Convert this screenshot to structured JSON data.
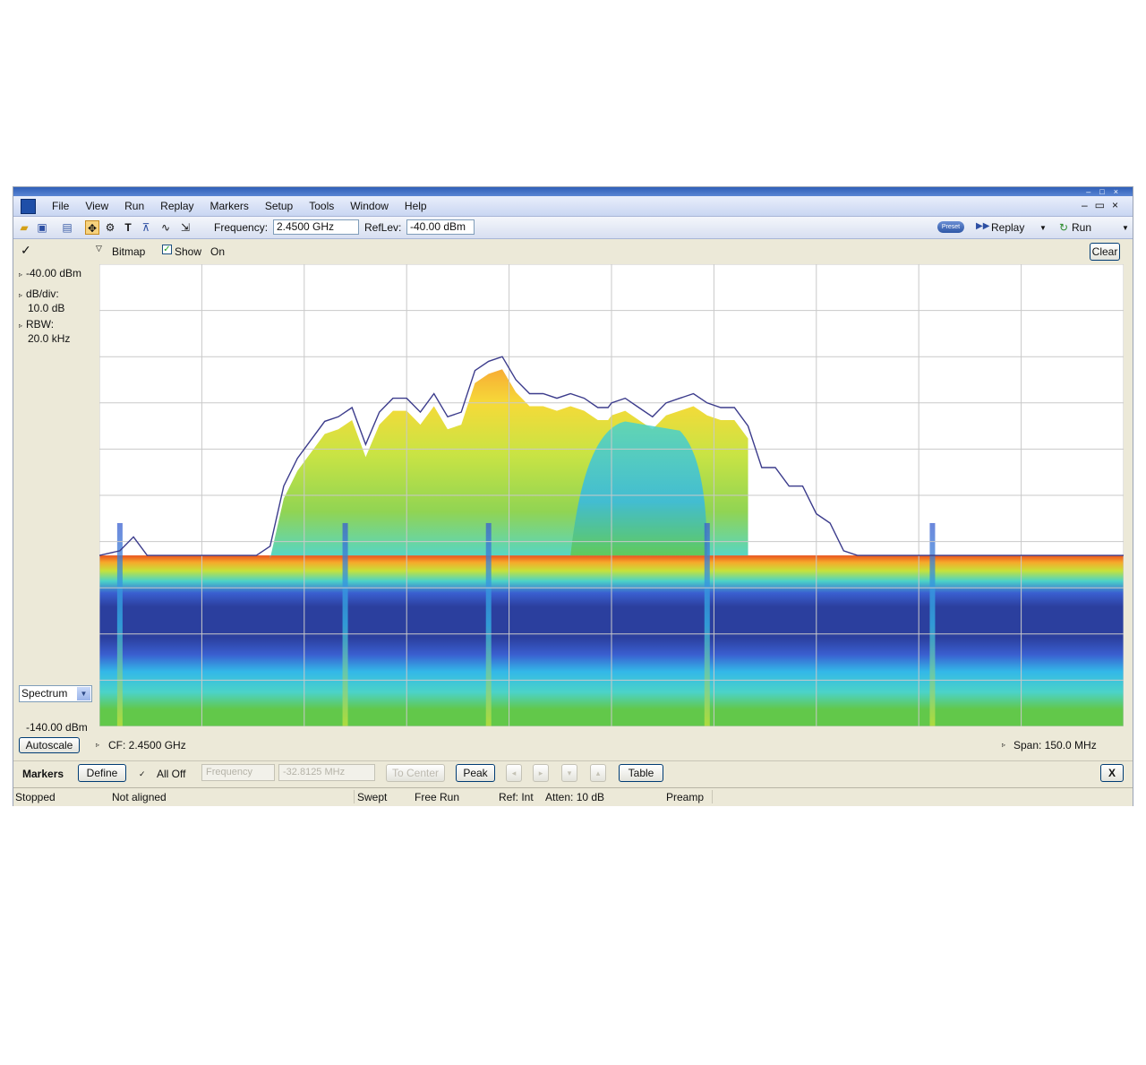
{
  "menu": [
    "File",
    "View",
    "Run",
    "Replay",
    "Markers",
    "Setup",
    "Tools",
    "Window",
    "Help"
  ],
  "toolbar": {
    "frequency_label": "Frequency:",
    "frequency_value": "2.4500 GHz",
    "reflev_label": "RefLev:",
    "reflev_value": "-40.00 dBm",
    "preset_label": "Preset",
    "replay_label": "Replay",
    "run_label": "Run"
  },
  "trace": {
    "mode": "Bitmap",
    "show_label": "Show",
    "show_checked": true,
    "state": "On",
    "clear_label": "Clear"
  },
  "left": {
    "ref_level": "-40.00 dBm",
    "dbdiv_label": "dB/div:",
    "dbdiv_value": "10.0 dB",
    "rbw_label": "RBW:",
    "rbw_value": "20.0 kHz",
    "display_select": "Spectrum",
    "bottom_level": "-140.00 dBm",
    "autoscale_label": "Autoscale"
  },
  "readout": {
    "cf": "CF: 2.4500 GHz",
    "span": "Span: 150.0 MHz"
  },
  "markers": {
    "title": "Markers",
    "define_label": "Define",
    "alloff_label": "All Off",
    "param_select": "Frequency",
    "param_value": "-32.8125 MHz",
    "tocenter_label": "To Center",
    "peak_label": "Peak",
    "table_label": "Table",
    "close_label": "X"
  },
  "status": {
    "state": "Stopped",
    "align": "Not aligned",
    "mode": "Swept",
    "trigger": "Free Run",
    "ref": "Ref: Int",
    "atten": "Atten: 10 dB",
    "preamp": "Preamp"
  },
  "chart_data": {
    "type": "line",
    "xlabel": "",
    "ylabel": "",
    "center_frequency_ghz": 2.45,
    "span_mhz": 150,
    "xlim_mhz": [
      -75,
      75
    ],
    "ylim_dbm": [
      -140,
      -40
    ],
    "grid": true,
    "x_divisions": 10,
    "y_divisions": 10,
    "series": [
      {
        "x": [
          -75,
          -72,
          -70,
          -68,
          -65,
          -60,
          -55,
          -52,
          -50,
          -48,
          -46,
          -44,
          -42,
          -40,
          -38,
          -36,
          -34,
          -32,
          -30,
          -28,
          -26,
          -24,
          -22,
          -20,
          -18,
          -16,
          -14,
          -12,
          -10,
          -8,
          -6,
          -4,
          -2,
          0,
          2,
          4,
          6,
          8,
          10,
          12,
          14,
          16,
          18,
          -0.5,
          20,
          22,
          24,
          26,
          28,
          30,
          32,
          34,
          36,
          38,
          40,
          42,
          44,
          46,
          48,
          50,
          52,
          54,
          56,
          58,
          60,
          62,
          64,
          66,
          68,
          70,
          72,
          75
        ],
        "y": [
          -103,
          -102,
          -99,
          -103,
          -103,
          -103,
          -103,
          -103,
          -101,
          -88,
          -82,
          -78,
          -74,
          -73,
          -71,
          -79,
          -72,
          -69,
          -69,
          -72,
          -68,
          -73,
          -72,
          -63,
          -61,
          -60,
          -65,
          -68,
          -68,
          -69,
          -68,
          -69,
          -71,
          -70,
          -69,
          -71,
          -73,
          -70,
          -69,
          -68,
          -70,
          -71,
          -71,
          -71,
          -75,
          -84,
          -84,
          -88,
          -88,
          -94,
          -96,
          -102,
          -103,
          -103,
          -103,
          -103,
          -103,
          -103,
          -103,
          -103,
          -103,
          -103,
          -103,
          -103,
          -103,
          -103,
          -103,
          -103,
          -103,
          -103,
          -103,
          -103
        ]
      }
    ],
    "colorscale": [
      "#2b3f9e",
      "#3a5fd0",
      "#33b8e8",
      "#4bd3c8",
      "#62c84a",
      "#c6e23a",
      "#f5d82e",
      "#f7a82a",
      "#e8521e"
    ]
  }
}
